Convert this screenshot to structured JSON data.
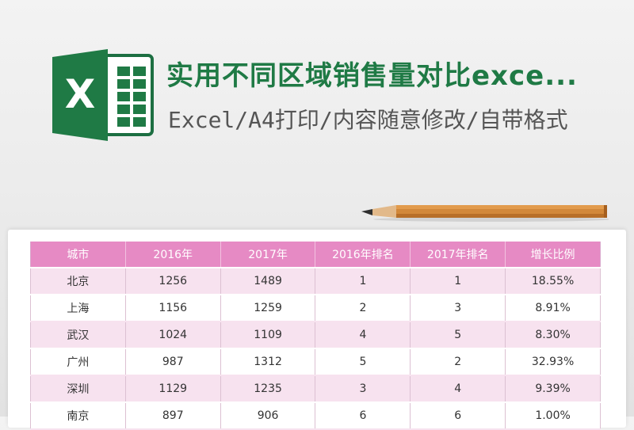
{
  "colors": {
    "brand_green": "#1f7a45",
    "header_pink": "#e68ac4",
    "row_pink": "#f7e2ef"
  },
  "logo": {
    "icon": "excel-icon",
    "letter": "X"
  },
  "title": "实用不同区域销售量对比exce...",
  "subtitle": "Excel/A4打印/内容随意修改/自带格式",
  "decoration": {
    "icon": "pencil-icon"
  },
  "table": {
    "headers": [
      "城市",
      "2016年",
      "2017年",
      "2016年排名",
      "2017年排名",
      "增长比例"
    ],
    "rows": [
      [
        "北京",
        "1256",
        "1489",
        "1",
        "1",
        "18.55%"
      ],
      [
        "上海",
        "1156",
        "1259",
        "2",
        "3",
        "8.91%"
      ],
      [
        "武汉",
        "1024",
        "1109",
        "4",
        "5",
        "8.30%"
      ],
      [
        "广州",
        "987",
        "1312",
        "5",
        "2",
        "32.93%"
      ],
      [
        "深圳",
        "1129",
        "1235",
        "3",
        "4",
        "9.39%"
      ],
      [
        "南京",
        "897",
        "906",
        "6",
        "6",
        "1.00%"
      ]
    ]
  }
}
